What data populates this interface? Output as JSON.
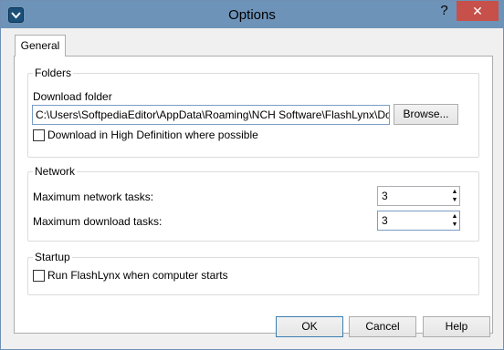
{
  "window": {
    "title": "Options",
    "help_glyph": "?",
    "close_glyph": "✕"
  },
  "tabs": [
    {
      "label": "General"
    }
  ],
  "folders": {
    "group_label": "Folders",
    "download_folder_label": "Download folder",
    "download_folder_value": "C:\\Users\\SoftpediaEditor\\AppData\\Roaming\\NCH Software\\FlashLynx\\Downloa",
    "browse_label": "Browse...",
    "hd_checkbox_label": "Download in High Definition where possible",
    "hd_checked": false
  },
  "network": {
    "group_label": "Network",
    "max_network_label": "Maximum network tasks:",
    "max_network_value": "3",
    "max_download_label": "Maximum download tasks:",
    "max_download_value": "3"
  },
  "startup": {
    "group_label": "Startup",
    "run_at_startup_label": "Run FlashLynx when computer starts",
    "run_at_startup_checked": false
  },
  "footer": {
    "ok_label": "OK",
    "cancel_label": "Cancel",
    "help_label": "Help"
  }
}
